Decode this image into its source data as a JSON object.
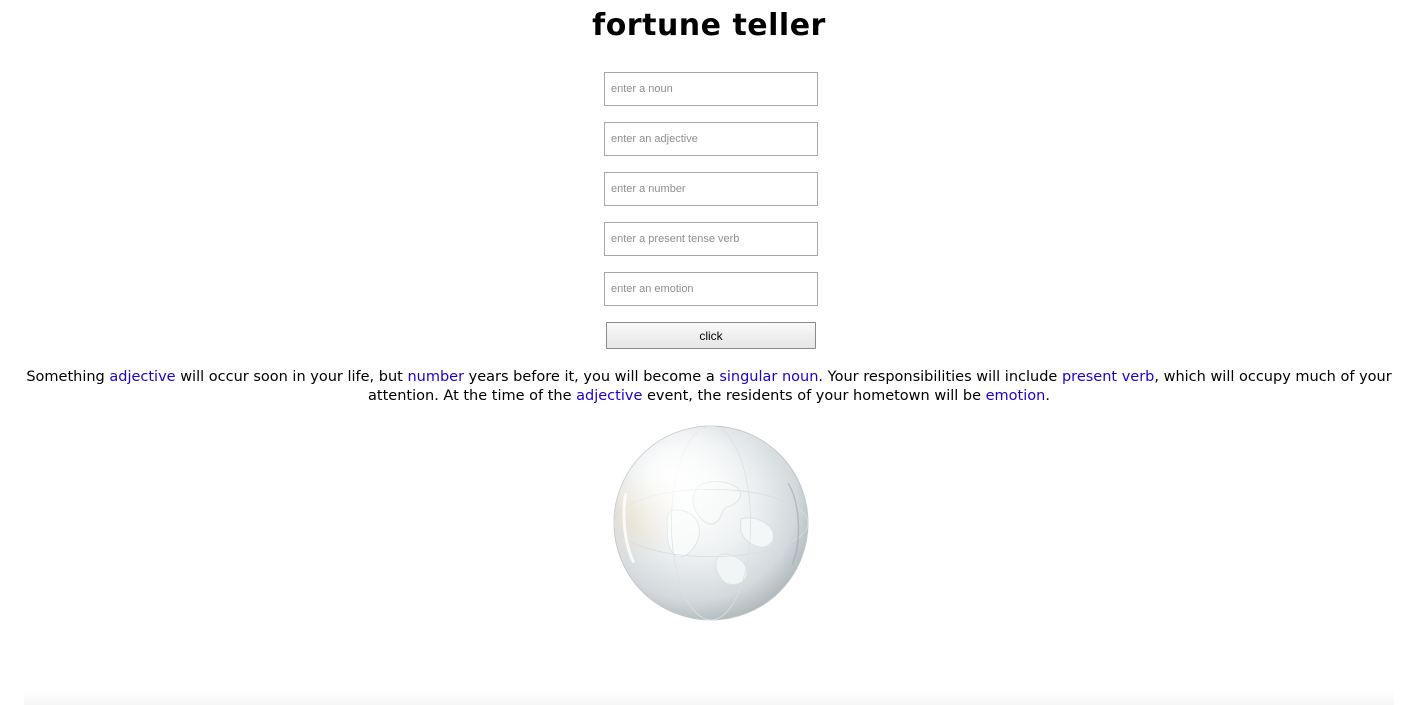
{
  "page": {
    "title": "fortune teller"
  },
  "form": {
    "noun_placeholder": "enter a noun",
    "adjective_placeholder": "enter an adjective",
    "number_placeholder": "enter a number",
    "verb_placeholder": "enter a present tense verb",
    "emotion_placeholder": "enter an emotion",
    "noun_value": "",
    "adjective_value": "",
    "number_value": "",
    "verb_value": "",
    "emotion_value": "",
    "button_label": "click"
  },
  "fortune": {
    "t1": "Something ",
    "adjective": "adjective",
    "t2": " will occur soon in your life, but ",
    "number": "number",
    "t3": " years before it, you will become a ",
    "noun": "singular noun",
    "t4": ". Your responsibilities will include ",
    "verb": "present verb",
    "t5": ", which will occupy much of your attention. At the time of the ",
    "adjective2": "adjective",
    "t6": " event, the residents of your hometown will be ",
    "emotion": "emotion",
    "t7": "."
  },
  "colors": {
    "blank_text": "#2200cc"
  },
  "icons": {
    "orb": "crystal-ball-globe-icon"
  }
}
